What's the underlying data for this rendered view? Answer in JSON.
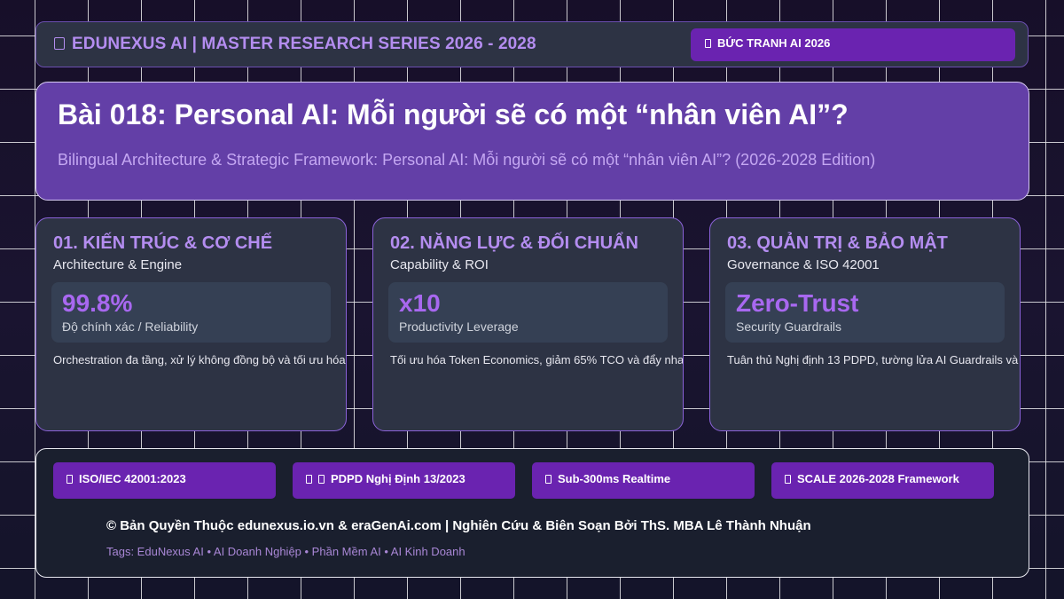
{
  "header": {
    "brand": "EDUNEXUS AI | MASTER RESEARCH SERIES 2026 - 2028",
    "brand_icon": "box-icon",
    "badge": "BỨC TRANH AI 2026"
  },
  "hero": {
    "title": "Bài 018: Personal AI: Mỗi người sẽ có một “nhân viên AI”?",
    "subtitle": "Bilingual Architecture & Strategic Framework: Personal AI: Mỗi người sẽ có một “nhân viên AI”? (2026-2028 Edition)"
  },
  "cards": [
    {
      "title": "01. KIẾN TRÚC & CƠ CHẾ",
      "subtitle": "Architecture & Engine",
      "metric_value": "99.8%",
      "metric_label": "Độ chính xác / Reliability",
      "description": "Orchestration đa tầng, xử lý không đồng bộ và tối ưu hóa bộ nhớ"
    },
    {
      "title": "02. NĂNG LỰC & ĐỐI CHUẨN",
      "subtitle": "Capability & ROI",
      "metric_value": "x10",
      "metric_label": "Productivity Leverage",
      "description": "Tối ưu hóa Token Economics, giảm 65% TCO và đẩy nhanh chu kỳ"
    },
    {
      "title": "03. QUẢN TRỊ & BẢO MẬT",
      "subtitle": "Governance & ISO 42001",
      "metric_value": "Zero-Trust",
      "metric_label": "Security Guardrails",
      "description": "Tuân thủ Nghị định 13 PDPD, tường lửa AI Guardrails và kiểm toán"
    }
  ],
  "footer": {
    "chips": [
      "ISO/IEC 42001:2023",
      "PDPD Nghị Định 13/2023",
      "Sub-300ms Realtime",
      "SCALE 2026-2028 Framework"
    ],
    "copyright": "© Bản Quyền Thuộc edunexus.io.vn & eraGenAi.com | Nghiên Cứu & Biên Soạn Bởi ThS. MBA Lê Thành Nhuận",
    "tags": "Tags: EduNexus AI • AI Doanh Nghiệp • Phần Mềm AI • AI Kinh Doanh"
  },
  "colors": {
    "accent": "#b48df0",
    "badge": "#6a23b0",
    "hero": "#633fa7",
    "card": "#2d3344"
  }
}
